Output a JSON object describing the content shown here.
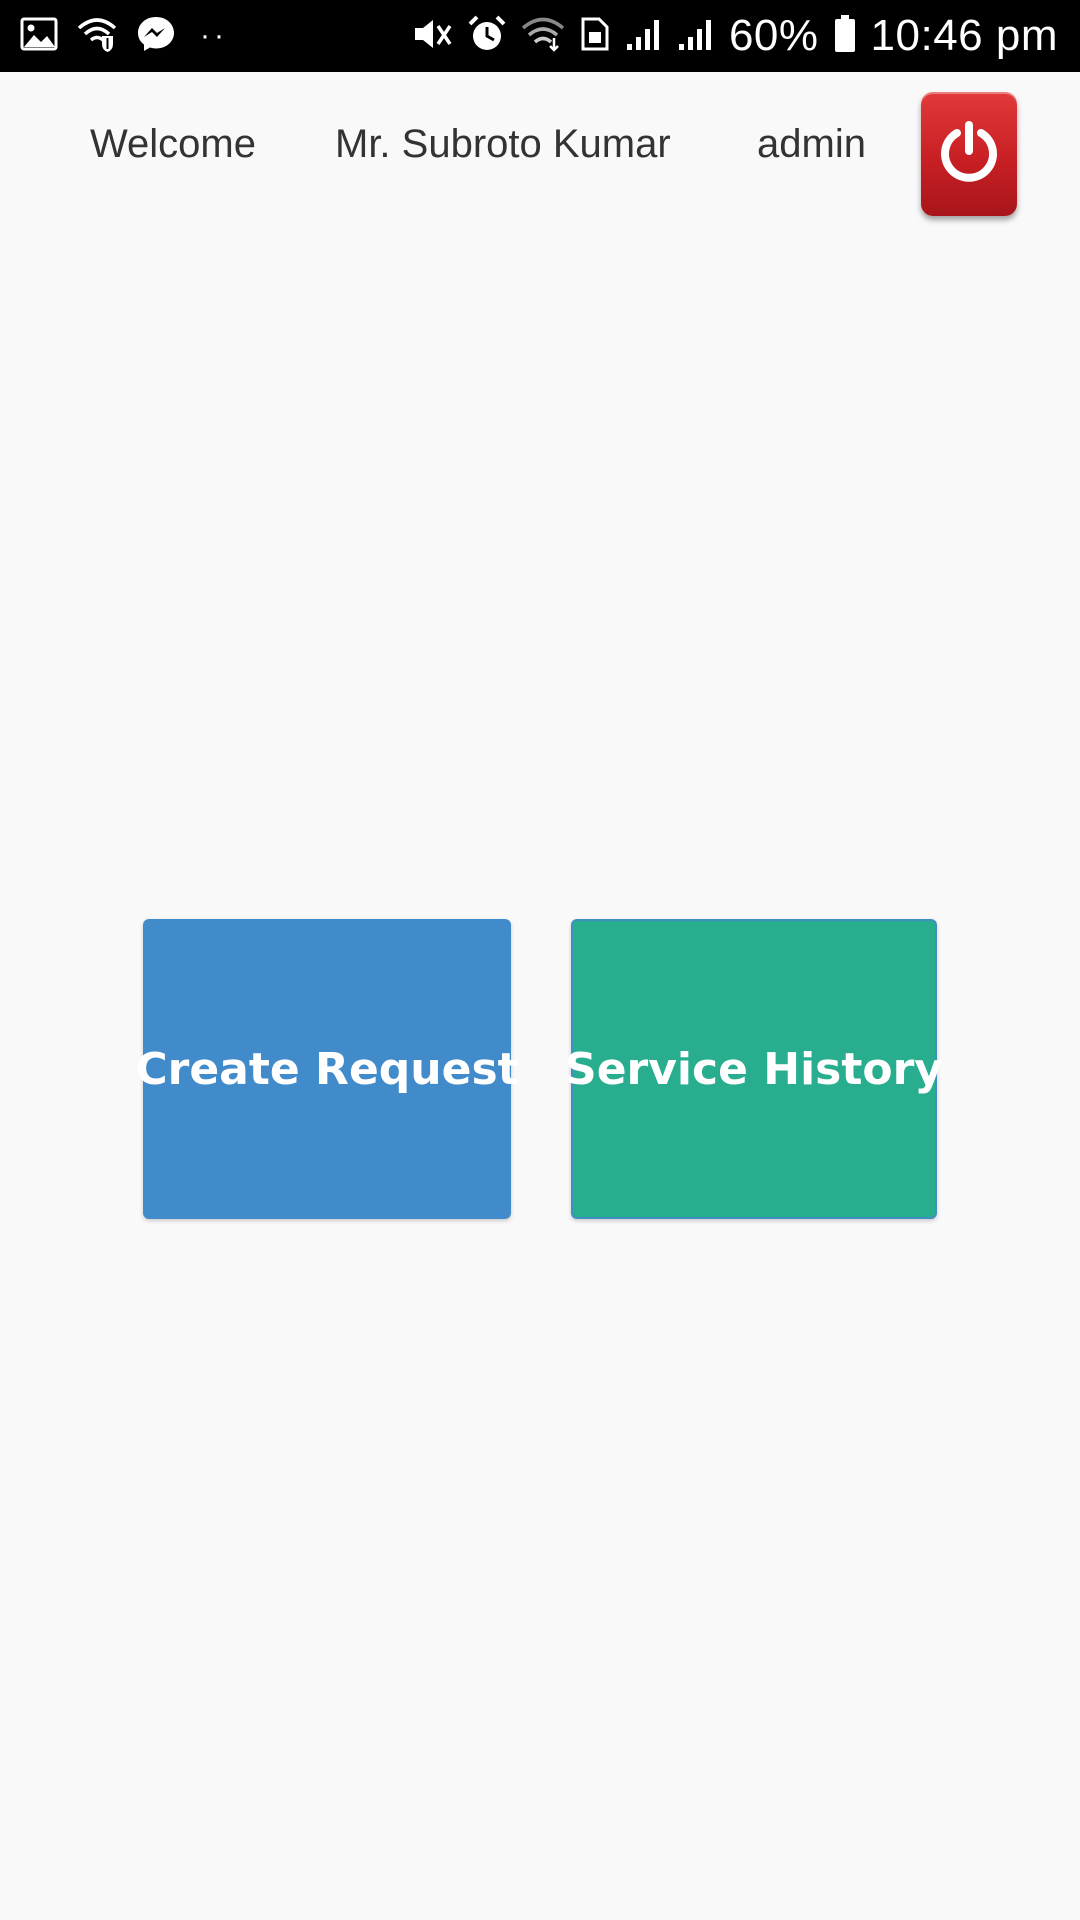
{
  "status_bar": {
    "battery_percent": "60%",
    "time": "10:46 pm",
    "left_icons": [
      "image-icon",
      "wifi-shield-icon",
      "messenger-icon"
    ],
    "right_icons": [
      "vibrate-mute-icon",
      "alarm-icon",
      "wifi-icon",
      "sim-icon",
      "signal-icon",
      "signal-icon",
      "battery-icon"
    ],
    "extra_notifications": "··"
  },
  "header": {
    "welcome": "Welcome",
    "username": "Mr. Subroto Kumar",
    "role": "admin",
    "power_icon": "power-icon",
    "power_color": "#d32a2f"
  },
  "actions": {
    "create_request": "Create Request",
    "service_history": "Service History",
    "create_color": "#428bca",
    "history_color": "#28ae8f"
  }
}
